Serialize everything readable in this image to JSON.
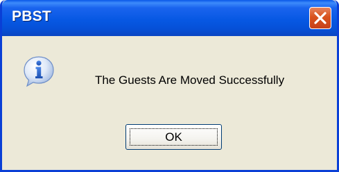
{
  "dialog": {
    "title": "PBST",
    "message": "The Guests Are Moved Successfully",
    "ok_label": "OK",
    "icon": "info-icon",
    "close_icon": "close-icon"
  },
  "colors": {
    "title_bar": "#0758e3",
    "title_text": "#ffffff",
    "close_button": "#d8521d",
    "body_background": "#ece9d8",
    "info_icon_blue": "#2f6fd0"
  }
}
